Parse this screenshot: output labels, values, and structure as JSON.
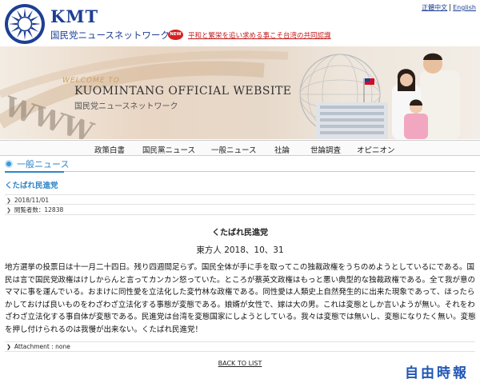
{
  "header": {
    "brand": "KMT",
    "brand_sub": "国民党ニュースネットワーク",
    "new_badge": "NEW",
    "headline_link": "平和と繁栄を追い求める事こそ台湾の共同認識",
    "lang_zh": "正體中文",
    "lang_en": "English"
  },
  "banner": {
    "welcome": "WELCOME TO",
    "title": "KUOMINTANG OFFICIAL WEBSITE",
    "subtitle": "国民党ニュースネットワーク",
    "www": "WWW"
  },
  "nav": {
    "items": [
      "政策白書",
      "国民黨ニュース",
      "一般ニュース",
      "社論",
      "世論調査",
      "オピニオン"
    ]
  },
  "section": {
    "title": "一般ニュース",
    "breadcrumb": "くたばれ民進党"
  },
  "article": {
    "date_meta": "2018/11/01",
    "views_meta": "閲覧者数：12838",
    "title": "くたばれ民進党",
    "byline": "東方人 2018、10、31",
    "body": "地方選挙の投票日は十一月二十四日。残り四週間足らず。国民全体が手に手を取ってこの独裁政権をうちのめようとしているにである。国民は言で国民党政権はけしからんと言ってカンカン怒っていた。ところが蔡英文政権はもっと悪い典型的な独裁政権である。全て我が意のママに事を運んでいる。おまけに同性愛を立法化した変竹林な政権である。同性愛は人類史上自然発生的に出来た現象であって、ほったらかしておけば良いものをわざわざ立法化する事態が変態である。娘婿が女性で、嫁は大の男。これは変態としか言いようが無い。それをわざわざ立法化する事自体が変態である。民進党は台湾を変態国家にしようとしている。我々は変態では無いし、変態になりたく無い。変態を押し付けられるのは我慢が出来ない。くたばれ民進党！",
    "attachment": "Attachment : none",
    "back_link": "BACK TO LIST"
  },
  "watermark": "自由時報",
  "colors": {
    "brand_blue": "#1d3f93",
    "link_blue": "#2f86c8",
    "headline_red": "#c01818"
  }
}
